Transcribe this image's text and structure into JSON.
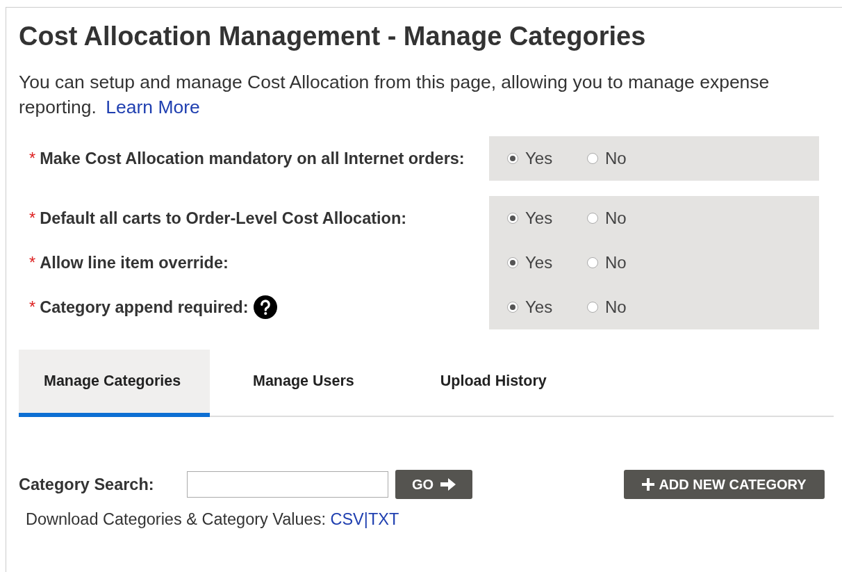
{
  "title": "Cost Allocation Management - Manage Categories",
  "description": {
    "text": "You can setup and manage Cost Allocation from this page, allowing you to manage expense reporting.",
    "link": "Learn More"
  },
  "setting_groups": [
    {
      "settings": [
        {
          "required_mark": "*",
          "label": "Make Cost Allocation mandatory on all Internet orders:",
          "has_help": false,
          "options": [
            {
              "label": "Yes",
              "selected": true
            },
            {
              "label": "No",
              "selected": false
            }
          ]
        }
      ]
    },
    {
      "settings": [
        {
          "required_mark": "*",
          "label": "Default all carts to Order-Level Cost Allocation:",
          "has_help": false,
          "options": [
            {
              "label": "Yes",
              "selected": true
            },
            {
              "label": "No",
              "selected": false
            }
          ]
        },
        {
          "required_mark": "*",
          "label": "Allow line item override:",
          "has_help": false,
          "options": [
            {
              "label": "Yes",
              "selected": true
            },
            {
              "label": "No",
              "selected": false
            }
          ]
        },
        {
          "required_mark": "*",
          "label": "Category append required:",
          "has_help": true,
          "options": [
            {
              "label": "Yes",
              "selected": true
            },
            {
              "label": "No",
              "selected": false
            }
          ]
        }
      ]
    }
  ],
  "tabs": [
    {
      "label": "Manage Categories",
      "selected": true
    },
    {
      "label": "Manage Users",
      "selected": false
    },
    {
      "label": "Upload History",
      "selected": false
    }
  ],
  "search": {
    "label": "Category Search:",
    "button": "GO"
  },
  "add_button": "ADD NEW CATEGORY",
  "download": {
    "label": "Download Categories & Category Values:",
    "links": [
      "CSV",
      "TXT"
    ],
    "separator": "|"
  }
}
